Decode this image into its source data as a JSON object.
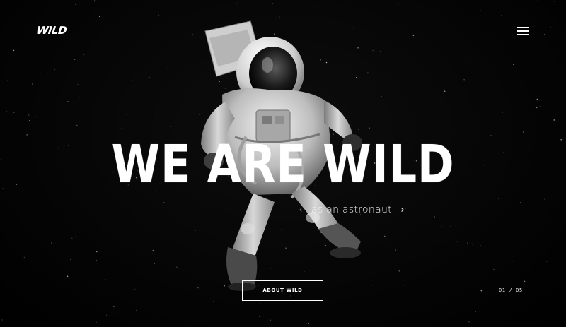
{
  "brand": {
    "logo_text": "WILD"
  },
  "header": {
    "menu_icon": "hamburger-menu-icon"
  },
  "hero": {
    "title": "WE ARE WILD",
    "subtitle": "as an astronaut",
    "prev_arrow": "‹",
    "next_arrow": "›",
    "image_subject": "astronaut-in-space"
  },
  "cta": {
    "about_label": "ABOUT WILD"
  },
  "slider": {
    "current": "01",
    "total": "05",
    "separator": "/"
  },
  "colors": {
    "background": "#000000",
    "text": "#ffffff",
    "muted": "#777777"
  }
}
